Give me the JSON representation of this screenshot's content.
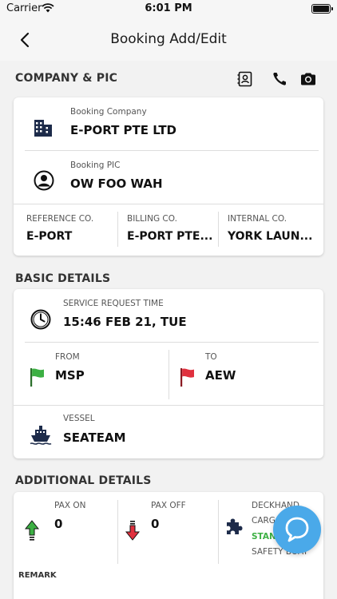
{
  "status_bar": {
    "carrier": "Carrier",
    "time": "6:01 PM"
  },
  "nav": {
    "title": "Booking Add/Edit"
  },
  "company_section": {
    "title": "COMPANY & PIC",
    "booking_company": {
      "label": "Booking Company",
      "value": "E-PORT PTE LTD"
    },
    "booking_pic": {
      "label": "Booking PIC",
      "value": "OW FOO WAH"
    },
    "reference_co": {
      "label": "REFERENCE CO.",
      "value": "E-PORT"
    },
    "billing_co": {
      "label": "BILLING CO.",
      "value": "E-PORT PTE..."
    },
    "internal_co": {
      "label": "INTERNAL CO.",
      "value": "YORK LAUN..."
    }
  },
  "basic_section": {
    "title": "BASIC DETAILS",
    "service_request": {
      "label": "SERVICE REQUEST TIME",
      "value": "15:46 FEB 21, TUE"
    },
    "from": {
      "label": "FROM",
      "value": "MSP"
    },
    "to": {
      "label": "TO",
      "value": "AEW"
    },
    "vessel": {
      "label": "VESSEL",
      "value": "SEATEAM"
    }
  },
  "additional_section": {
    "title": "ADDITIONAL DETAILS",
    "pax_on": {
      "label": "PAX ON",
      "value": "0"
    },
    "pax_off": {
      "label": "PAX OFF",
      "value": "0"
    },
    "deckhand": {
      "label": "DECKHAND"
    },
    "cargo": {
      "label": "CARGO"
    },
    "standard": {
      "label": "STANDARD"
    },
    "safety_boat": {
      "label": "SAFETY BOAT"
    },
    "remark": {
      "label": "REMARK"
    }
  },
  "colors": {
    "accent_blue": "#4aa9e9",
    "flag_green": "#3cb043",
    "flag_red": "#e0303e",
    "standard_green": "#3cb043"
  },
  "icons": [
    "wifi-icon",
    "battery-icon",
    "back-chevron-icon",
    "contacts-icon",
    "phone-icon",
    "camera-icon",
    "building-icon",
    "person-icon",
    "clock-icon",
    "green-flag-icon",
    "red-flag-icon",
    "ship-icon",
    "arrow-up-icon",
    "arrow-down-icon",
    "puzzle-icon",
    "chat-icon"
  ]
}
